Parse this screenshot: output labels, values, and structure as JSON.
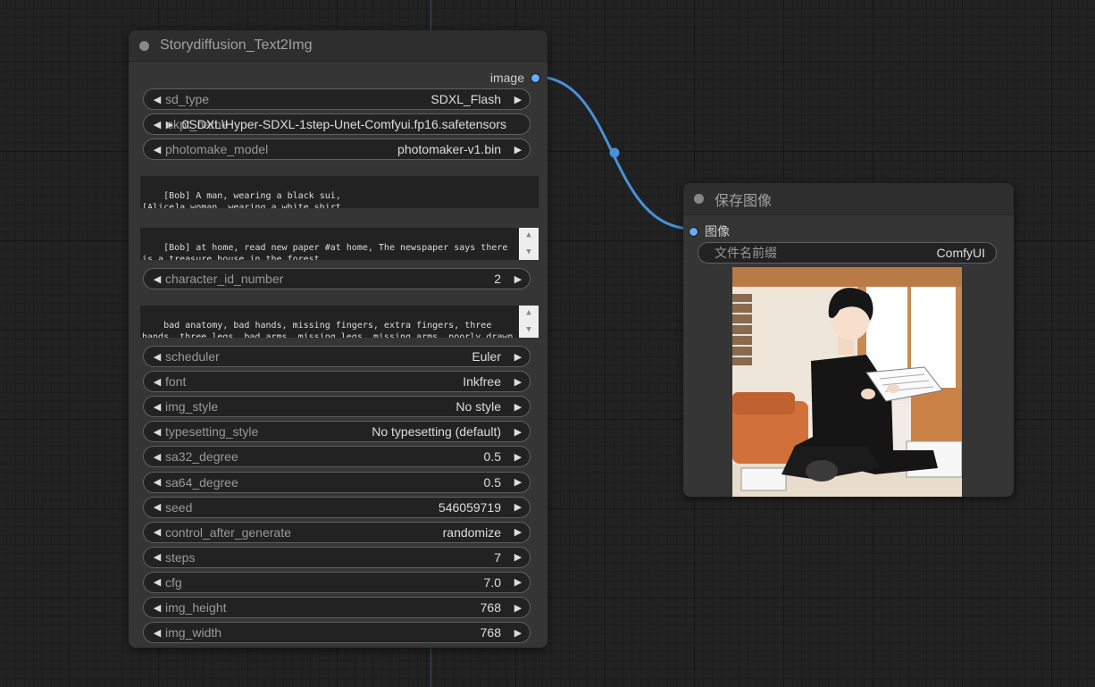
{
  "colors": {
    "canvas_bg": "#222222",
    "node_bg": "#353535",
    "link": "#4a90d9",
    "port": "#6aa9f3"
  },
  "story_node": {
    "title": "Storydiffusion_Text2Img",
    "output_label": "image",
    "widgets_top": [
      {
        "label": "sd_type",
        "value": "SDXL_Flash"
      },
      {
        "label": "ckpt_name",
        "value": "0SDXL\\Hyper-SDXL-1step-Unet-Comfyui.fp16.safetensors"
      },
      {
        "label": "photomake_model",
        "value": "photomaker-v1.bin"
      }
    ],
    "character_prompt": "[Bob] A man, wearing a black sui,\n[Alice]a woman, wearing a white shirt.",
    "scene_prompts": "[Bob] at home, read new paper #at home, The newspaper says there is a treasure house in the forest.\n[Bob] on the road, near the forest",
    "character_id": {
      "label": "character_id_number",
      "value": "2"
    },
    "negative_prompt": "bad anatomy, bad hands, missing fingers, extra fingers, three hands, three legs, bad arms, missing legs, missing arms, poorly drawn face, bad face, fused face, cloned face, three arms, fused feet, fused thigh",
    "widgets_bottom": [
      {
        "label": "scheduler",
        "value": "Euler"
      },
      {
        "label": "font",
        "value": "Inkfree"
      },
      {
        "label": "img_style",
        "value": "No style"
      },
      {
        "label": "typesetting_style",
        "value": "No typesetting (default)"
      },
      {
        "label": "sa32_degree",
        "value": "0.5"
      },
      {
        "label": "sa64_degree",
        "value": "0.5"
      },
      {
        "label": "seed",
        "value": "546059719"
      },
      {
        "label": "control_after_generate",
        "value": "randomize"
      },
      {
        "label": "steps",
        "value": "7"
      },
      {
        "label": "cfg",
        "value": "7.0"
      },
      {
        "label": "img_height",
        "value": "768"
      },
      {
        "label": "img_width",
        "value": "768"
      }
    ]
  },
  "save_node": {
    "title": "保存图像",
    "input_label": "图像",
    "filename_prefix": {
      "label": "文件名前缀",
      "value": "ComfyUI"
    }
  }
}
